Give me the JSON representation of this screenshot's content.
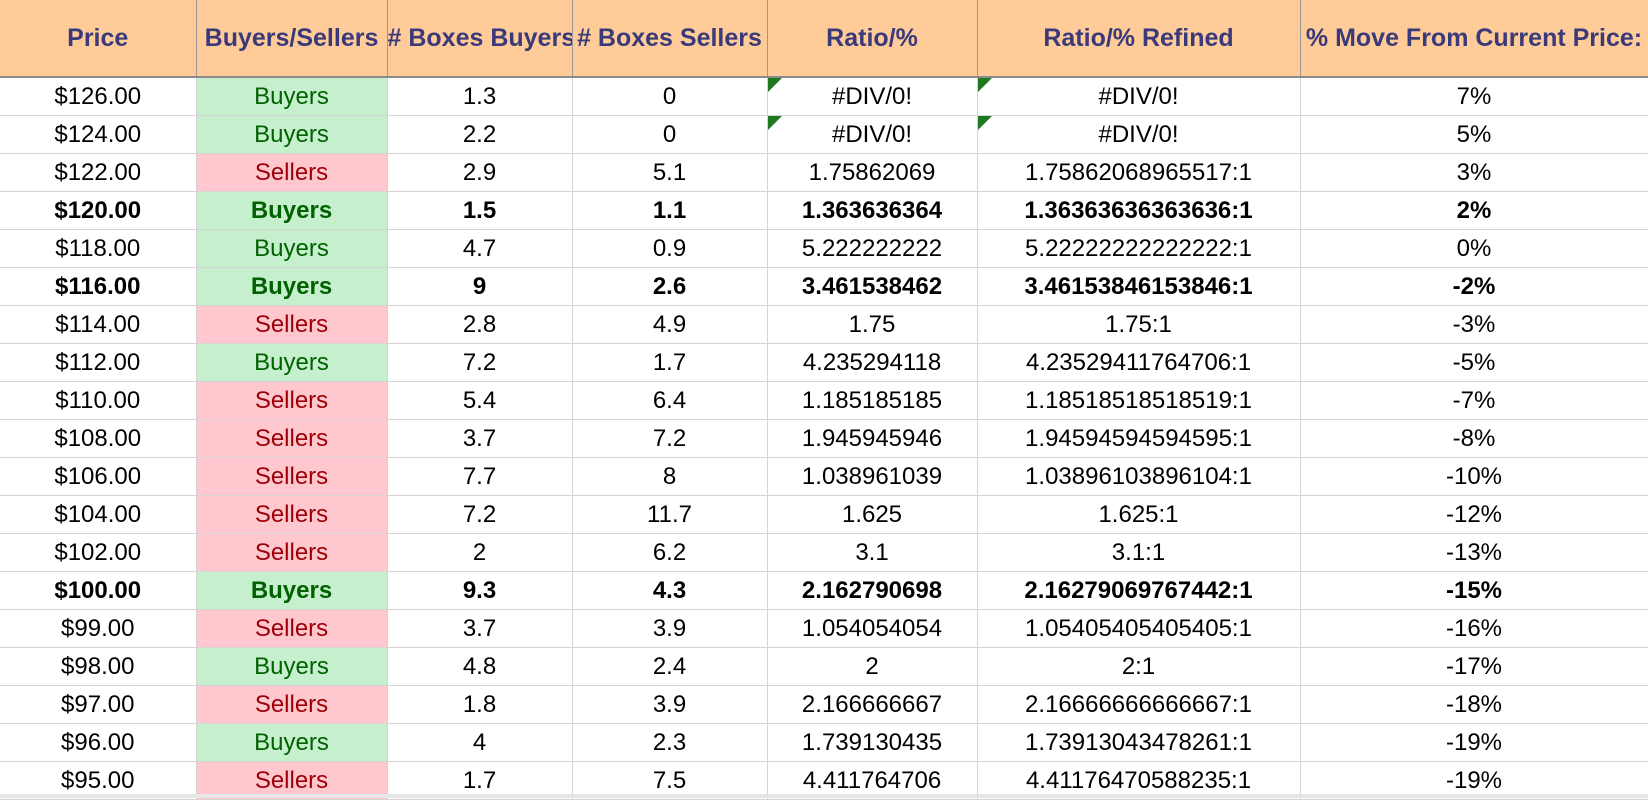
{
  "headers": [
    "Price",
    "Buyers/Sellers",
    "# Boxes Buyers",
    "# Boxes Sellers",
    "Ratio/%",
    "Ratio/% Refined",
    "% Move From Current Price:"
  ],
  "rows": [
    {
      "price": "$126.00",
      "bs": "Buyers",
      "buyers": "1.3",
      "sellers": "0",
      "ratio": "#DIV/0!",
      "refined": "#DIV/0!",
      "move": "7%",
      "bold": false,
      "flag": true
    },
    {
      "price": "$124.00",
      "bs": "Buyers",
      "buyers": "2.2",
      "sellers": "0",
      "ratio": "#DIV/0!",
      "refined": "#DIV/0!",
      "move": "5%",
      "bold": false,
      "flag": true
    },
    {
      "price": "$122.00",
      "bs": "Sellers",
      "buyers": "2.9",
      "sellers": "5.1",
      "ratio": "1.75862069",
      "refined": "1.75862068965517:1",
      "move": "3%",
      "bold": false,
      "flag": false
    },
    {
      "price": "$120.00",
      "bs": "Buyers",
      "buyers": "1.5",
      "sellers": "1.1",
      "ratio": "1.363636364",
      "refined": "1.36363636363636:1",
      "move": "2%",
      "bold": true,
      "flag": false
    },
    {
      "price": "$118.00",
      "bs": "Buyers",
      "buyers": "4.7",
      "sellers": "0.9",
      "ratio": "5.222222222",
      "refined": "5.22222222222222:1",
      "move": "0%",
      "bold": false,
      "flag": false
    },
    {
      "price": "$116.00",
      "bs": "Buyers",
      "buyers": "9",
      "sellers": "2.6",
      "ratio": "3.461538462",
      "refined": "3.46153846153846:1",
      "move": "-2%",
      "bold": true,
      "flag": false
    },
    {
      "price": "$114.00",
      "bs": "Sellers",
      "buyers": "2.8",
      "sellers": "4.9",
      "ratio": "1.75",
      "refined": "1.75:1",
      "move": "-3%",
      "bold": false,
      "flag": false
    },
    {
      "price": "$112.00",
      "bs": "Buyers",
      "buyers": "7.2",
      "sellers": "1.7",
      "ratio": "4.235294118",
      "refined": "4.23529411764706:1",
      "move": "-5%",
      "bold": false,
      "flag": false
    },
    {
      "price": "$110.00",
      "bs": "Sellers",
      "buyers": "5.4",
      "sellers": "6.4",
      "ratio": "1.185185185",
      "refined": "1.18518518518519:1",
      "move": "-7%",
      "bold": false,
      "flag": false
    },
    {
      "price": "$108.00",
      "bs": "Sellers",
      "buyers": "3.7",
      "sellers": "7.2",
      "ratio": "1.945945946",
      "refined": "1.94594594594595:1",
      "move": "-8%",
      "bold": false,
      "flag": false
    },
    {
      "price": "$106.00",
      "bs": "Sellers",
      "buyers": "7.7",
      "sellers": "8",
      "ratio": "1.038961039",
      "refined": "1.03896103896104:1",
      "move": "-10%",
      "bold": false,
      "flag": false
    },
    {
      "price": "$104.00",
      "bs": "Sellers",
      "buyers": "7.2",
      "sellers": "11.7",
      "ratio": "1.625",
      "refined": "1.625:1",
      "move": "-12%",
      "bold": false,
      "flag": false
    },
    {
      "price": "$102.00",
      "bs": "Sellers",
      "buyers": "2",
      "sellers": "6.2",
      "ratio": "3.1",
      "refined": "3.1:1",
      "move": "-13%",
      "bold": false,
      "flag": false
    },
    {
      "price": "$100.00",
      "bs": "Buyers",
      "buyers": "9.3",
      "sellers": "4.3",
      "ratio": "2.162790698",
      "refined": "2.16279069767442:1",
      "move": "-15%",
      "bold": true,
      "flag": false
    },
    {
      "price": "$99.00",
      "bs": "Sellers",
      "buyers": "3.7",
      "sellers": "3.9",
      "ratio": "1.054054054",
      "refined": "1.05405405405405:1",
      "move": "-16%",
      "bold": false,
      "flag": false
    },
    {
      "price": "$98.00",
      "bs": "Buyers",
      "buyers": "4.8",
      "sellers": "2.4",
      "ratio": "2",
      "refined": "2:1",
      "move": "-17%",
      "bold": false,
      "flag": false
    },
    {
      "price": "$97.00",
      "bs": "Sellers",
      "buyers": "1.8",
      "sellers": "3.9",
      "ratio": "2.166666667",
      "refined": "2.16666666666667:1",
      "move": "-18%",
      "bold": false,
      "flag": false
    },
    {
      "price": "$96.00",
      "bs": "Buyers",
      "buyers": "4",
      "sellers": "2.3",
      "ratio": "1.739130435",
      "refined": "1.73913043478261:1",
      "move": "-19%",
      "bold": false,
      "flag": false
    },
    {
      "price": "$95.00",
      "bs": "Sellers",
      "buyers": "1.7",
      "sellers": "7.5",
      "ratio": "4.411764706",
      "refined": "4.41176470588235:1",
      "move": "-19%",
      "bold": false,
      "flag": false
    }
  ],
  "colors": {
    "header_bg": "#FFCC99",
    "header_text": "#3A3A7A",
    "buyers_bg": "#C6EFCE",
    "buyers_text": "#006100",
    "sellers_bg": "#FFC7CE",
    "sellers_text": "#9C0006",
    "error_flag": "#1F7A1F"
  }
}
